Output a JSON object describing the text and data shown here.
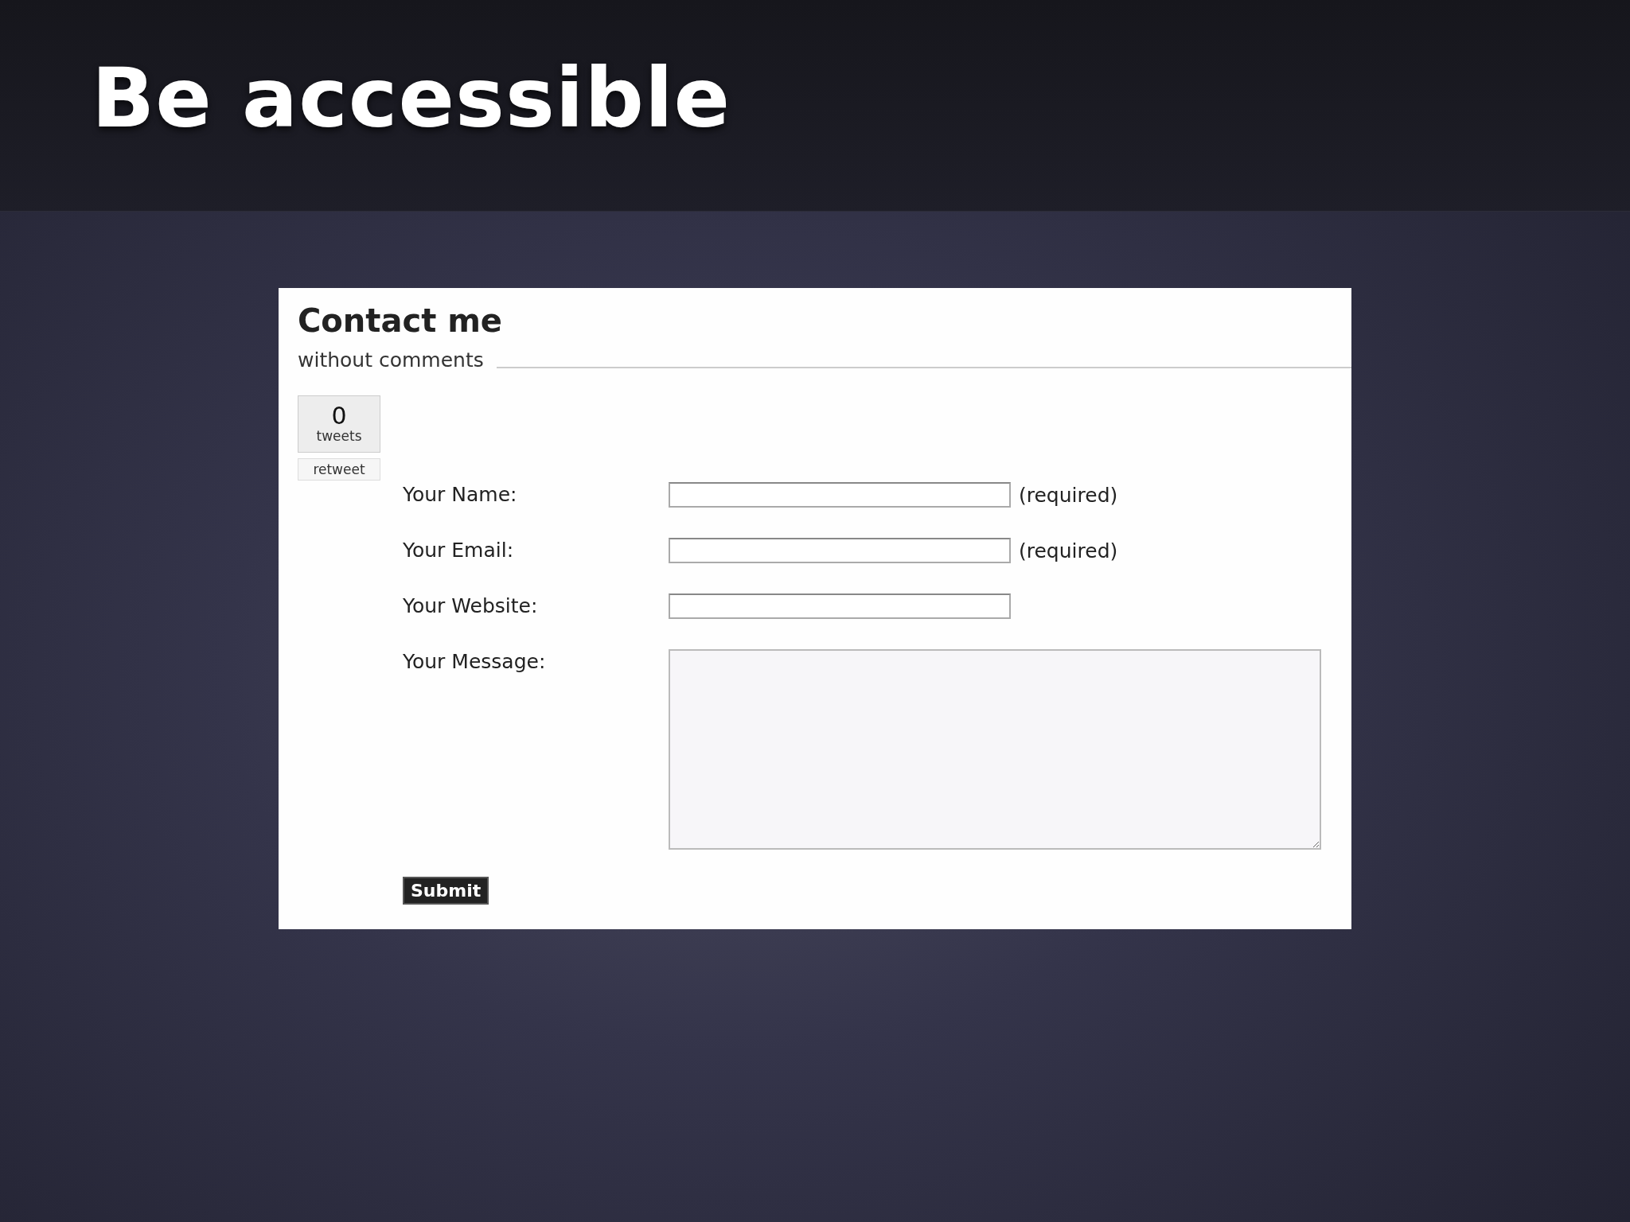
{
  "slide": {
    "title": "Be accessible"
  },
  "page": {
    "heading": "Contact me",
    "subtitle": "without comments",
    "tweet_widget": {
      "count": "0",
      "unit": "tweets",
      "button": "retweet"
    },
    "fields": [
      {
        "kind": "input",
        "label": "Your Name:",
        "note": "(required)"
      },
      {
        "kind": "input",
        "label": "Your Email:",
        "note": "(required)"
      },
      {
        "kind": "input",
        "label": "Your Website:"
      },
      {
        "kind": "textarea",
        "label": "Your Message:"
      }
    ],
    "submit": "Submit"
  }
}
